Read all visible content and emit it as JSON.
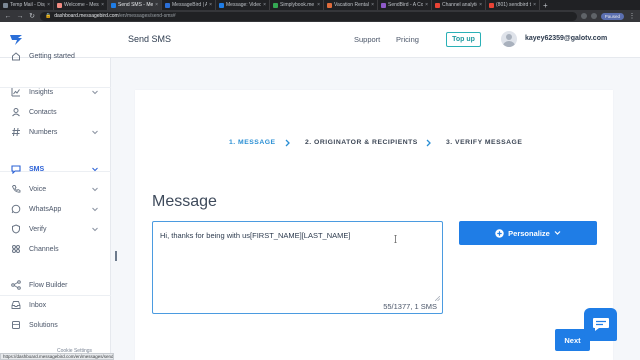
{
  "browser": {
    "tabs": [
      {
        "label": "Temp Mail - Disp"
      },
      {
        "label": "Welcome - Messa"
      },
      {
        "label": "Send SMS - Mess",
        "active": true
      },
      {
        "label": "MessageBird | An"
      },
      {
        "label": "Message: Video Y"
      },
      {
        "label": "Simplybook.me"
      },
      {
        "label": "Vacation Rental S"
      },
      {
        "label": "SendBird - A Con"
      },
      {
        "label": "Channel analytics"
      },
      {
        "label": "(801) sendbird tu"
      }
    ],
    "new_tab": "+",
    "url_host": "dashboard.messagebird.com",
    "url_path": "/en/messages/send-sms#",
    "paused_label": "Paused",
    "status_url": "https://dashboard.messagebird.com/en/messages/send-sms#"
  },
  "header": {
    "title": "Send SMS",
    "support": "Support",
    "pricing": "Pricing",
    "top_up": "Top up",
    "user_email": "kayey62359@galotv.com"
  },
  "sidebar": {
    "items": [
      {
        "label": "Getting started",
        "icon": "home-icon"
      },
      {
        "label": "Insights",
        "icon": "insights-icon",
        "chevron": true
      },
      {
        "label": "Contacts",
        "icon": "contacts-icon"
      },
      {
        "label": "Numbers",
        "icon": "numbers-icon",
        "chevron": true
      },
      {
        "label": "SMS",
        "icon": "sms-icon",
        "chevron": true,
        "active": true
      },
      {
        "label": "Voice",
        "icon": "voice-icon",
        "chevron": true
      },
      {
        "label": "WhatsApp",
        "icon": "whatsapp-icon",
        "chevron": true
      },
      {
        "label": "Verify",
        "icon": "verify-icon",
        "chevron": true
      },
      {
        "label": "Channels",
        "icon": "channels-icon"
      },
      {
        "label": "Flow Builder",
        "icon": "flow-builder-icon"
      },
      {
        "label": "Inbox",
        "icon": "inbox-icon"
      },
      {
        "label": "Solutions",
        "icon": "solutions-icon"
      }
    ],
    "cookie_settings": "Cookie Settings"
  },
  "steps": [
    {
      "label": "1. MESSAGE",
      "active": true
    },
    {
      "label": "2. ORIGINATOR & RECIPIENTS"
    },
    {
      "label": "3. VERIFY MESSAGE"
    }
  ],
  "message": {
    "heading": "Message",
    "body": "Hi, thanks for being with us[FIRST_NAME][LAST_NAME]",
    "counter": "55/1377, 1 SMS",
    "personalize_label": "Personalize"
  },
  "actions": {
    "next": "Next"
  },
  "colors": {
    "brand": "#1f7de6",
    "accent": "#2ab0b6",
    "active_step": "#2a8fd4"
  }
}
